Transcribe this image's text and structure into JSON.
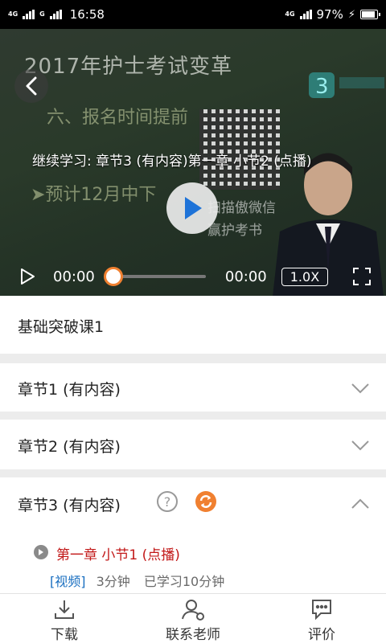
{
  "status_bar": {
    "network1": "4G",
    "network2": "G",
    "time": "16:58",
    "network3": "4G",
    "battery": "97%"
  },
  "player": {
    "board_title": "2017年护士考试变革",
    "board_line1": "六、报名时间提前",
    "board_line2": "➤预计12月中下",
    "board_line3": "扫描傲微信",
    "board_line4": "赢护考书",
    "overlay_title": "继续学习: 章节3 (有内容)第一章 小节2 (点播)",
    "time_current": "00:00",
    "time_total": "00:00",
    "speed": "1.0X",
    "progress_fraction": 0
  },
  "course": {
    "title": "基础突破课1"
  },
  "chapters": [
    {
      "label": "章节1 (有内容)"
    },
    {
      "label": "章节2  (有内容)"
    },
    {
      "label": "章节3 (有内容)"
    }
  ],
  "lesson": {
    "title": "第一章 小节1 (点播)",
    "tag": "[视频]",
    "duration": "3分钟",
    "progress": "已学习10分钟"
  },
  "bottom_nav": [
    {
      "label": "下载",
      "icon": "download-icon"
    },
    {
      "label": "联系老师",
      "icon": "user-chat-icon"
    },
    {
      "label": "评价",
      "icon": "comment-icon"
    }
  ],
  "colors": {
    "accent_orange": "#f08030",
    "lesson_red": "#c21818",
    "tag_blue": "#1a6fc0"
  }
}
